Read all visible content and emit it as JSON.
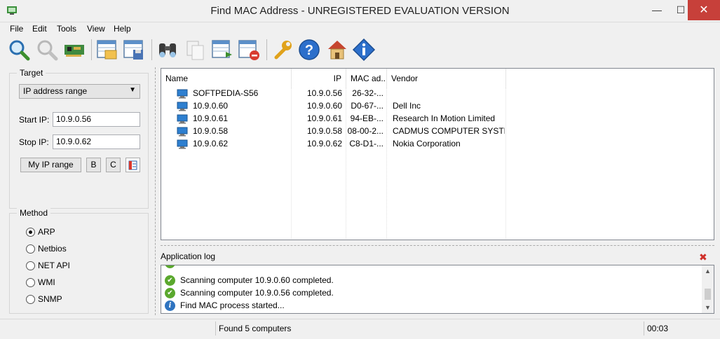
{
  "window": {
    "title": "Find MAC Address - UNREGISTERED EVALUATION VERSION",
    "min_glyph": "—",
    "max_glyph": "☐",
    "close_glyph": "✕"
  },
  "menu": [
    "File",
    "Edit",
    "Tools",
    "View",
    "Help"
  ],
  "toolbar": {
    "icons": [
      "find-mac-icon",
      "stop-search-icon",
      "network-card-icon",
      "open-list-icon",
      "save-list-icon",
      "find-binoculars-icon",
      "copy-icon",
      "export-list-icon",
      "delete-list-icon",
      "options-wrench-icon",
      "help-icon",
      "home-icon",
      "about-info-icon"
    ]
  },
  "target": {
    "group_title": "Target",
    "range_type": "IP address range",
    "start_ip_label": "Start IP:",
    "start_ip": "10.9.0.56",
    "stop_ip_label": "Stop IP:",
    "stop_ip": "10.9.0.62",
    "my_ip_range_label": "My IP range",
    "b_label": "B",
    "c_label": "C"
  },
  "method": {
    "group_title": "Method",
    "options": [
      {
        "label": "ARP",
        "checked": true
      },
      {
        "label": "Netbios",
        "checked": false
      },
      {
        "label": "NET API",
        "checked": false
      },
      {
        "label": "WMI",
        "checked": false
      },
      {
        "label": "SNMP",
        "checked": false
      }
    ]
  },
  "results": {
    "columns": [
      "Name",
      "IP",
      "MAC ad...",
      "Vendor"
    ],
    "rows": [
      {
        "name": "SOFTPEDIA-S56",
        "ip": "10.9.0.56",
        "mac": "26-32-...",
        "vendor": ""
      },
      {
        "name": "10.9.0.60",
        "ip": "10.9.0.60",
        "mac": "D0-67-...",
        "vendor": "Dell Inc"
      },
      {
        "name": "10.9.0.61",
        "ip": "10.9.0.61",
        "mac": "94-EB-...",
        "vendor": "Research In Motion Limited"
      },
      {
        "name": "10.9.0.58",
        "ip": "10.9.0.58",
        "mac": "08-00-2...",
        "vendor": "CADMUS COMPUTER SYSTE..."
      },
      {
        "name": "10.9.0.62",
        "ip": "10.9.0.62",
        "mac": "C8-D1-...",
        "vendor": "Nokia Corporation"
      }
    ]
  },
  "log": {
    "title": "Application log",
    "close_glyph": "✖",
    "lines": [
      {
        "icon": "ok",
        "text": "Scanning computer 10.9.0.60 completed."
      },
      {
        "icon": "ok",
        "text": "Scanning computer 10.9.0.56 completed."
      },
      {
        "icon": "info",
        "text": "Find MAC process started..."
      }
    ]
  },
  "status": {
    "message": "Found 5 computers",
    "elapsed": "00:03"
  },
  "colors": {
    "close_button": "#c7403a",
    "ok_icon": "#5aa82d",
    "info_icon": "#2f74c0",
    "pc_icon": "#2e7fd0"
  }
}
